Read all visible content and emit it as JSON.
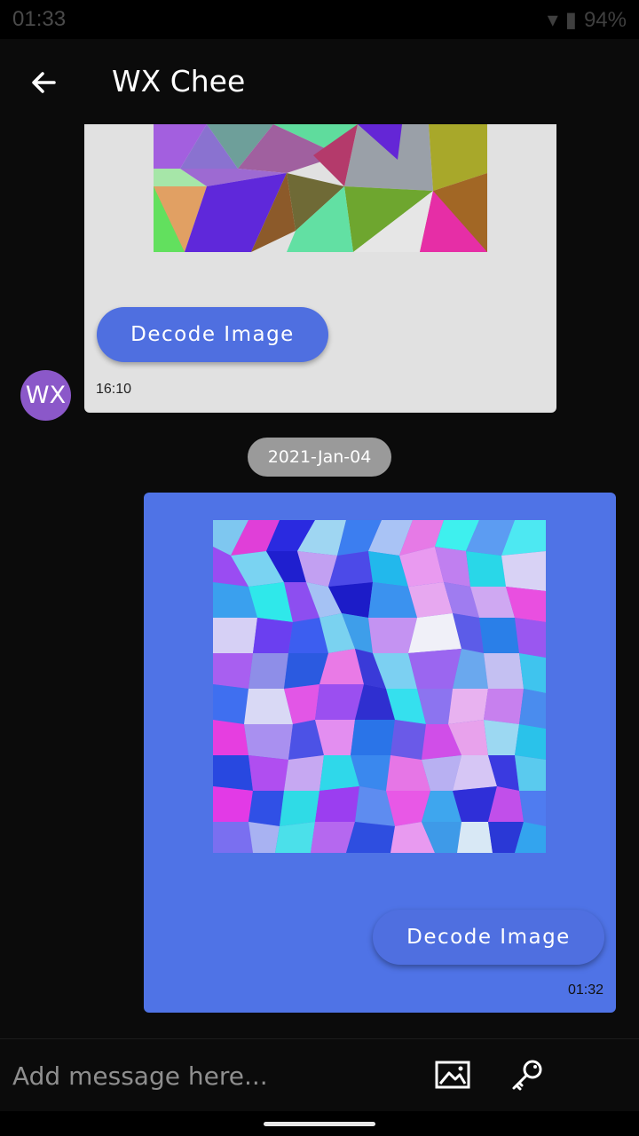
{
  "status_bar": {
    "time": "01:33",
    "battery": "94%"
  },
  "header": {
    "title": "WX Chee"
  },
  "messages": {
    "incoming": {
      "avatar_initials": "WX",
      "button_label": "Decode Image",
      "time": "16:10"
    },
    "date_separator": "2021-Jan-04",
    "outgoing": {
      "button_label": "Decode Image",
      "time": "01:32"
    }
  },
  "composer": {
    "placeholder": "Add message here..."
  },
  "icons": {
    "back": "arrow-left-icon",
    "image": "image-icon",
    "key": "key-icon"
  },
  "colors": {
    "outgoing_bubble": "#4f73e6",
    "incoming_bubble": "#e1e1e1",
    "button": "#4f6fe0",
    "avatar": "#8b58c9",
    "date_chip": "#9a9a9a"
  }
}
